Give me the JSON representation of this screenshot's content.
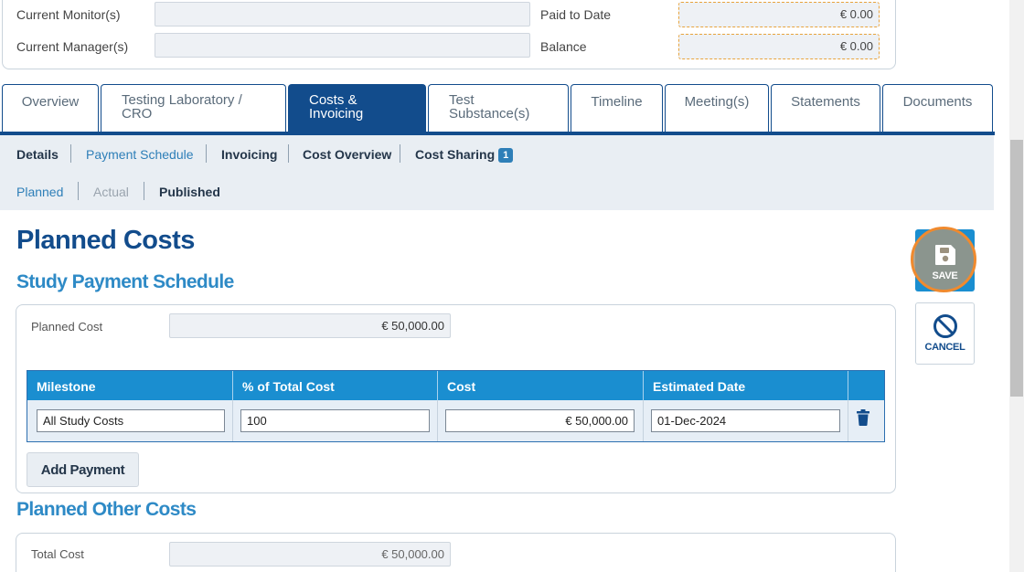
{
  "summary": {
    "current_monitors_label": "Current Monitor(s)",
    "current_managers_label": "Current Manager(s)",
    "paid_to_date_label": "Paid to Date",
    "paid_to_date_value": "€ 0.00",
    "balance_label": "Balance",
    "balance_value": "€ 0.00"
  },
  "tabs": [
    {
      "label": "Overview"
    },
    {
      "label": "Testing Laboratory /\nCRO"
    },
    {
      "label": "Costs &\nInvoicing",
      "active": true
    },
    {
      "label": "Test\nSubstance(s)"
    },
    {
      "label": "Timeline"
    },
    {
      "label": "Meeting(s)"
    },
    {
      "label": "Statements"
    },
    {
      "label": "Documents"
    }
  ],
  "subnav": {
    "details": "Details",
    "payment_schedule": "Payment Schedule",
    "invoicing": "Invoicing",
    "cost_overview": "Cost Overview",
    "cost_sharing": "Cost Sharing",
    "cost_sharing_badge": "1",
    "planned": "Planned",
    "actual": "Actual",
    "published": "Published"
  },
  "page_title": "Planned Costs",
  "study_payment": {
    "heading": "Study Payment Schedule",
    "planned_cost_label": "Planned Cost",
    "planned_cost_value": "€ 50,000.00",
    "columns": [
      "Milestone",
      "% of Total Cost",
      "Cost",
      "Estimated Date"
    ],
    "rows": [
      {
        "milestone": "All Study Costs",
        "percent": "100",
        "cost": "€ 50,000.00",
        "date": "01-Dec-2024"
      }
    ],
    "add_payment_label": "Add Payment"
  },
  "other_costs": {
    "heading": "Planned Other Costs",
    "total_cost_label": "Total Cost",
    "total_cost_value": "€ 50,000.00"
  },
  "actions": {
    "save_label": "SAVE",
    "cancel_label": "CANCEL"
  },
  "icons": [
    "save-icon",
    "cancel-icon",
    "trash-icon"
  ],
  "colors": {
    "primary": "#124c8c",
    "accent": "#1a8ed0",
    "highlight": "#f08a2e"
  }
}
